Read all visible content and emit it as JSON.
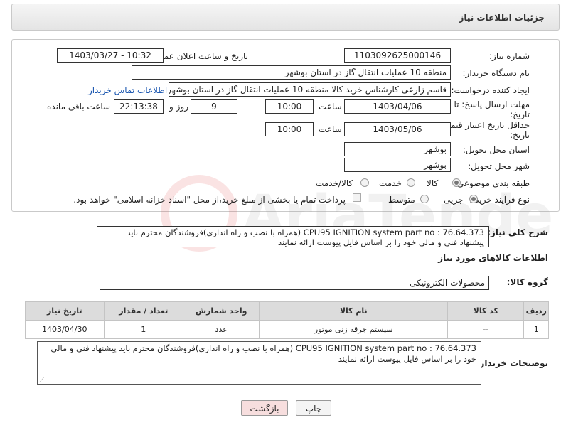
{
  "header": {
    "title": "جزئیات اطلاعات نیاز"
  },
  "form": {
    "need_number_label": "شماره نیاز:",
    "need_number": "1103092625000146",
    "announce_label": "تاریخ و ساعت اعلان عمومی:",
    "announce_value": "1403/03/27 - 10:32",
    "buyer_org_label": "نام دستگاه خریدار:",
    "buyer_org": "منطقه 10 عملیات انتقال گاز در استان بوشهر",
    "creator_label": "ایجاد کننده درخواست:",
    "creator": "قاسم زارعی کارشناس خرید کالا منطقه 10 عملیات انتقال گاز در استان بوشهر",
    "contact_link": "اطلاعات تماس خریدار",
    "deadline_label_1": "مهلت ارسال پاسخ: تا",
    "deadline_label_2": "تاریخ:",
    "deadline_date": "1403/04/06",
    "time_label": "ساعت",
    "deadline_time": "10:00",
    "days_value": "9",
    "days_label": "روز و",
    "remaining_time": "22:13:38",
    "remaining_label": "ساعت باقی مانده",
    "price_validity_label_1": "حداقل تاریخ اعتبار قیمت: تا",
    "price_validity_label_2": "تاریخ:",
    "price_validity_date": "1403/05/06",
    "price_validity_time": "10:00",
    "province_label": "استان محل تحویل:",
    "province": "بوشهر",
    "city_label": "شهر محل تحویل:",
    "city": "بوشهر",
    "category_label": "طبقه بندی موضوعی:",
    "category_options": [
      "کالا",
      "خدمت",
      "کالا/خدمت"
    ],
    "category_selected": "کالا",
    "process_label": "نوع فرآیند خرید :",
    "process_options": [
      "جزیی",
      "متوسط"
    ],
    "process_selected": "جزیی",
    "payment_note": "پرداخت تمام یا بخشی از مبلغ خرید،از محل \"اسناد خزانه اسلامی\" خواهد بود."
  },
  "watermark": {
    "text": "AriaTender.net"
  },
  "summary": {
    "label": "شرح کلی نیاز:",
    "text": "CPU95 IGNITION system part no : 76.64.373 (همراه با نصب و راه اندازی)فروشندگان محترم باید پیشنهاد فنی و مالی خود را بر اساس فایل پیوست ارائه نمایند"
  },
  "goods_section": {
    "title": "اطلاعات کالاهای مورد نیاز",
    "group_label": "گروه کالا:",
    "group_value": "محصولات الکترونیکی"
  },
  "table": {
    "headers": [
      "ردیف",
      "کد کالا",
      "نام کالا",
      "واحد شمارش",
      "تعداد / مقدار",
      "تاریخ نیاز"
    ],
    "rows": [
      [
        "1",
        "--",
        "سیستم جرقه زنی موتور",
        "عدد",
        "1",
        "1403/04/30"
      ]
    ]
  },
  "buyer_notes": {
    "label": "توضیحات خریدار:",
    "text": "CPU95 IGNITION system part no : 76.64.373 (همراه با نصب و راه اندازی)فروشندگان محترم باید پیشنهاد فنی و مالی خود را بر اساس فایل پیوست ارائه نمایند"
  },
  "buttons": {
    "print": "چاپ",
    "back": "بازگشت"
  },
  "colors": {
    "link": "#1a56b0",
    "back_button": "#f7dede",
    "header_bg": "#ececec"
  }
}
